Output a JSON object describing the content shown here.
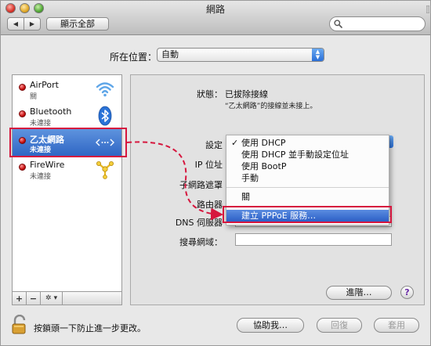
{
  "window": {
    "title": "網路"
  },
  "toolbar": {
    "back_glyph": "◀",
    "forward_glyph": "▶",
    "show_all_label": "顯示全部",
    "search_placeholder": ""
  },
  "location": {
    "label": "所在位置：",
    "value": "自動"
  },
  "sidebar": {
    "items": [
      {
        "name": "AirPort",
        "status": "關",
        "icon": "wifi-icon",
        "status_color": "#cc1111"
      },
      {
        "name": "Bluetooth",
        "status": "未連接",
        "icon": "bluetooth-icon",
        "status_color": "#cc1111"
      },
      {
        "name": "乙太網路",
        "status": "未連接",
        "icon": "ethernet-icon",
        "status_color": "#cc1111",
        "selected": true
      },
      {
        "name": "FireWire",
        "status": "未連接",
        "icon": "firewire-icon",
        "status_color": "#cc1111"
      }
    ],
    "buttons": {
      "add": "+",
      "remove": "−",
      "gear": "✲ ▾"
    }
  },
  "detail": {
    "status_label": "狀態：",
    "status_value": "已拔除接線",
    "status_note": "“乙太網路”的接線並未接上。",
    "config_label": "設定",
    "ip_label": "IP 位址",
    "subnet_label": "子網路遮罩",
    "router_label": "路由器",
    "dns_label": "DNS 伺服器",
    "search_domains_label": "搜尋網域：",
    "advanced_label": "進階…",
    "help_label": "?"
  },
  "config_menu": {
    "items": [
      {
        "label": "使用 DHCP",
        "checked": true
      },
      {
        "label": "使用 DHCP 並手動設定位址",
        "checked": false
      },
      {
        "label": "使用 BootP",
        "checked": false
      },
      {
        "label": "手動",
        "checked": false
      },
      {
        "label": "關",
        "checked": false
      },
      {
        "label": "建立 PPPoE 服務…",
        "checked": false,
        "highlighted": true
      }
    ],
    "check_glyph": "✓"
  },
  "footer": {
    "lock_text": "按鎖頭一下防止進一步更改。",
    "assist_label": "協助我…",
    "revert_label": "回復",
    "apply_label": "套用"
  },
  "colors": {
    "annotation": "#d6173e",
    "selection": "#2f66c4",
    "status_dot": "#cc1111"
  }
}
